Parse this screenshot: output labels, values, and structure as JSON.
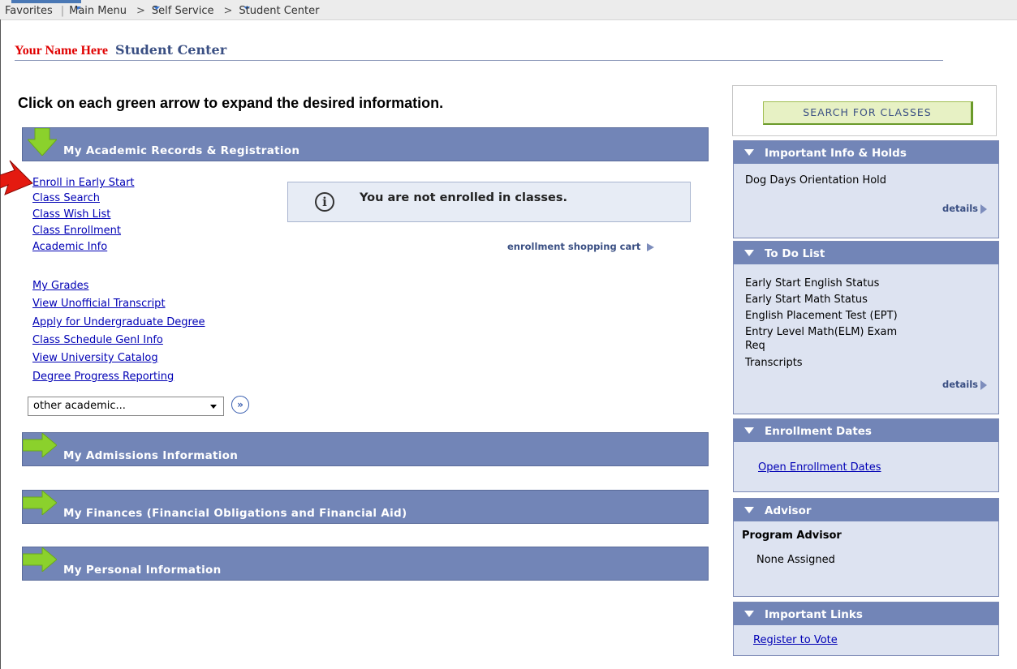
{
  "topnav": {
    "favorites": "Favorites",
    "main_menu": "Main Menu",
    "crumb_self_service": "Self Service",
    "crumb_student_center": "Student Center"
  },
  "header": {
    "name": "Your Name Here",
    "title": "Student Center"
  },
  "instructions": "Click on each green arrow to expand the desired information.",
  "sections": {
    "academic": "My Academic Records & Registration",
    "admissions": "My Admissions Information",
    "finances": "My Finances (Financial Obligations and Financial Aid)",
    "personal": "My Personal Information"
  },
  "academic_links": {
    "group1": [
      "Enroll in Early Start",
      "Class Search",
      "Class Wish List",
      "Class Enrollment",
      "Academic Info"
    ],
    "group2": [
      "My Grades",
      "View Unofficial Transcript",
      "Apply for Undergraduate Degree",
      "Class Schedule Genl Info",
      "View University Catalog",
      "Degree Progress Reporting"
    ]
  },
  "enrollment_notice": "You are not enrolled in classes.",
  "shopping_cart": "enrollment shopping cart",
  "other_academic": {
    "selected": "other academic..."
  },
  "search_button": "SEARCH FOR CLASSES",
  "pagelets": {
    "holds": {
      "title": "Important Info & Holds",
      "items": [
        "Dog Days Orientation Hold"
      ],
      "details": "details"
    },
    "todo": {
      "title": "To Do List",
      "items": [
        "Early Start English Status",
        "Early Start Math Status",
        "English Placement Test (EPT)",
        "Entry Level Math(ELM) Exam",
        "Req",
        "Transcripts"
      ],
      "details": "details"
    },
    "enrollment_dates": {
      "title": "Enrollment Dates",
      "link": "Open Enrollment Dates"
    },
    "advisor": {
      "title": "Advisor",
      "subtitle": "Program Advisor",
      "value": "None Assigned"
    },
    "important_links": {
      "title": "Important Links",
      "link": "Register to Vote"
    }
  },
  "colors": {
    "bar": "#7285b7",
    "link": "#0000b5",
    "name_red": "#e00000",
    "green_arrow": "#8bd12c"
  }
}
